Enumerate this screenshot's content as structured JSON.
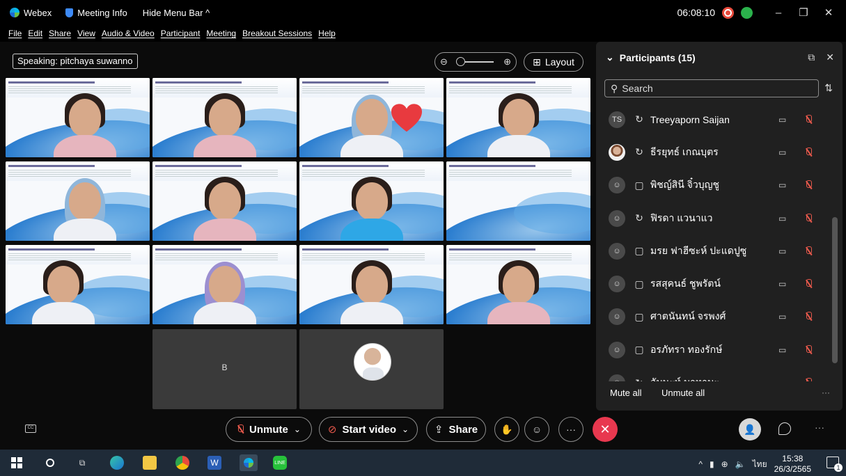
{
  "titlebar": {
    "app_name": "Webex",
    "meeting_info": "Meeting Info",
    "hide_menu": "Hide Menu Bar ^",
    "time": "06:08:10",
    "minimize": "–",
    "restore": "❐",
    "close": "✕"
  },
  "menu": [
    "File",
    "Edit",
    "Share",
    "View",
    "Audio & Video",
    "Participant",
    "Meeting",
    "Breakout Sessions",
    "Help"
  ],
  "stage": {
    "speaking": "Speaking: pitchaya suwanno",
    "layout_label": "Layout",
    "blank_tile_letter": "B"
  },
  "participants": {
    "title": "Participants (15)",
    "search_placeholder": "Search",
    "mute_all": "Mute all",
    "unmute_all": "Unmute all",
    "list": [
      {
        "initials": "TS",
        "name": "Treeyaporn Saijan"
      },
      {
        "initials": "",
        "name": "ธีรยุทธ์ เกณบุตร"
      },
      {
        "initials": "",
        "name": "พิชญ์สินี จิ๋วบุญชู"
      },
      {
        "initials": "",
        "name": "ฟิรดา แวนาแว"
      },
      {
        "initials": "",
        "name": "มรย ฟาฮีซะห์ ปะแดปูซู"
      },
      {
        "initials": "",
        "name": "รสสุคนธ์ ชูพรัตน์"
      },
      {
        "initials": "",
        "name": "ศาตนันทน์ จรพงศ์"
      },
      {
        "initials": "",
        "name": "อรภัทรา ทองรักษ์"
      },
      {
        "initials": "",
        "name": "อัมนะห์ มาหามะ"
      }
    ]
  },
  "controls": {
    "unmute": "Unmute",
    "start_video": "Start video",
    "share": "Share"
  },
  "taskbar": {
    "lang": "ไทย",
    "time": "15:38",
    "date": "26/3/2565",
    "notifications": "1"
  }
}
